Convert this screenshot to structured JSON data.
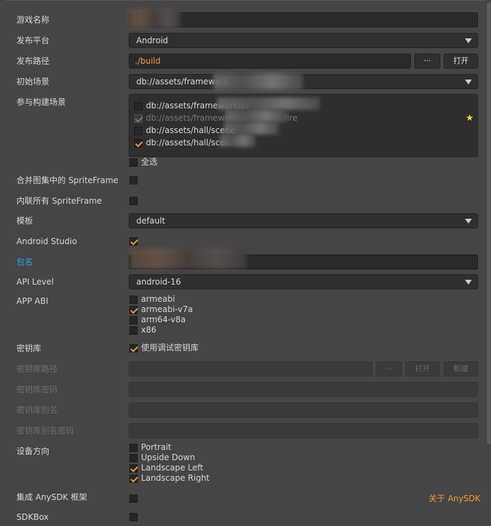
{
  "form": {
    "game_name": {
      "label": "游戏名称",
      "value": ""
    },
    "platform": {
      "label": "发布平台",
      "value": "Android"
    },
    "build_path": {
      "label": "发布路径",
      "value": "./build",
      "browse_label": "···",
      "open_label": "打开"
    },
    "start_scene": {
      "label": "初始场景",
      "value": "db://assets/framework"
    },
    "scenes": {
      "label": "参与构建场景",
      "items": [
        {
          "path": "db://assets/framework/sc",
          "checked": false
        },
        {
          "path": "db://assets/framework/sc",
          "suffix": "fire",
          "checked": true,
          "disabled": true
        },
        {
          "path": "db://assets/hall/scene",
          "checked": false
        },
        {
          "path": "db://assets/hall/scen",
          "checked": true
        }
      ],
      "select_all_label": "全选"
    },
    "merge_spriteframe": {
      "label": "合并图集中的 SpriteFrame"
    },
    "inline_spriteframe": {
      "label": "内联所有 SpriteFrame"
    },
    "template": {
      "label": "模板",
      "value": "default"
    },
    "android_studio": {
      "label": "Android Studio"
    },
    "package_name": {
      "label": "包名",
      "value": ""
    },
    "api_level": {
      "label": "API Level",
      "value": "android-16"
    },
    "app_abi": {
      "label": "APP ABI",
      "options": [
        "armeabi",
        "armeabi-v7a",
        "arm64-v8a",
        "x86"
      ]
    },
    "keystore": {
      "label": "密钥库",
      "debug_label": "使用调试密钥库"
    },
    "keystore_path": {
      "label": "密钥库路径",
      "browse_label": "···",
      "open_label": "打开",
      "new_label": "新建"
    },
    "keystore_password": {
      "label": "密钥库密码"
    },
    "keystore_alias": {
      "label": "密钥库别名"
    },
    "keystore_alias_password": {
      "label": "密钥库别名密码"
    },
    "orientation": {
      "label": "设备方向",
      "options": [
        "Portrait",
        "Upside Down",
        "Landscape Left",
        "Landscape Right"
      ]
    },
    "anysdk": {
      "label": "集成 AnySDK 框架",
      "link_label": "关于 AnySDK"
    },
    "sdkbox": {
      "label": "SDKBox"
    }
  },
  "colors": {
    "accent": "#f29a2e",
    "link_blue": "#31a4e8",
    "star": "#f5e12a"
  }
}
